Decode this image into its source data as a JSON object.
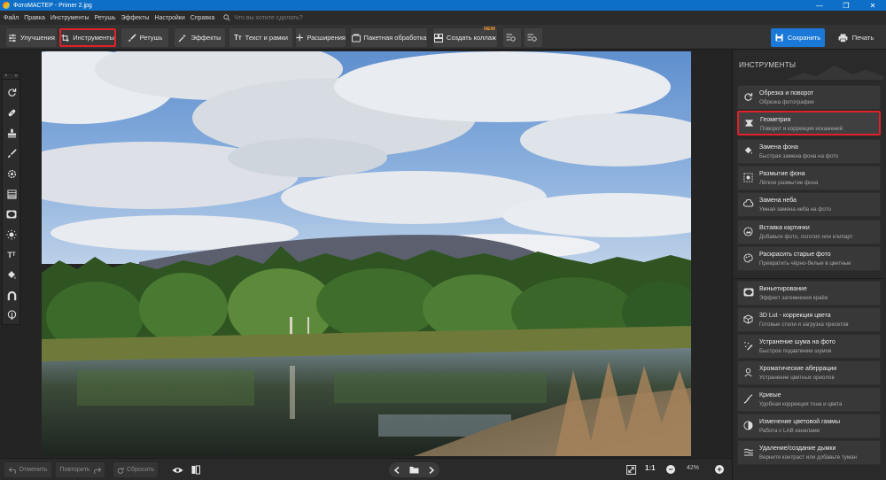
{
  "window": {
    "title": "ФотоМАСТЕР - Primer 2.jpg",
    "minimize": "—",
    "maximize": "❐",
    "close": "✕"
  },
  "menu": {
    "items": [
      "Файл",
      "Правка",
      "Инструменты",
      "Ретушь",
      "Эффекты",
      "Настройки",
      "Справка"
    ],
    "search_placeholder": "Что вы хотите сделать?"
  },
  "toolbar": {
    "improvements": "Улучшения",
    "tools": "Инструменты",
    "retouch": "Ретушь",
    "effects": "Эффекты",
    "text_frames": "Текст и рамки",
    "extensions": "Расширения",
    "batch": "Пакетная обработка",
    "collage": "Создать коллаж",
    "collage_badge": "NEW",
    "save": "Сохранить",
    "print": "Печать",
    "active_tab": "tools",
    "accent_color": "#1a78d8",
    "highlight_color": "#e0202a"
  },
  "left_tools": {
    "header_close": "×",
    "header_collapse": "«",
    "icons": [
      "rotate-icon",
      "patch-icon",
      "stamp-icon",
      "brush-icon",
      "gear-icon",
      "gradient-icon",
      "vignette-rect-icon",
      "sun-icon",
      "text-icon",
      "bucket-icon",
      "magnet-icon",
      "tree-icon"
    ]
  },
  "panel": {
    "title": "ИНСТРУМЕНТЫ",
    "items": [
      {
        "title": "Обрезка и поворот",
        "subtitle": "Обрезка фотографии",
        "icon": "crop-rotate-icon"
      },
      {
        "title": "Геометрия",
        "subtitle": "Поворот и коррекция искажений",
        "icon": "geometry-icon",
        "active": true
      },
      {
        "title": "Замена фона",
        "subtitle": "Быстрая замена фона на фото",
        "icon": "bucket-icon"
      },
      {
        "title": "Размытие фона",
        "subtitle": "Лёгкое размытие фона",
        "icon": "blur-icon"
      },
      {
        "title": "Замена неба",
        "subtitle": "Умная замена неба на фото",
        "icon": "cloud-icon"
      },
      {
        "title": "Вставка картинки",
        "subtitle": "Добавьте фото, логотип или клипарт",
        "icon": "image-insert-icon"
      },
      {
        "title": "Раскрасить старые фото",
        "subtitle": "Превратить чёрно-белые в цветные",
        "icon": "palette-icon"
      },
      {
        "title": "Виньетирование",
        "subtitle": "Эффект затемнения краёв",
        "icon": "vignette-icon"
      },
      {
        "title": "3D Lut - коррекция цвета",
        "subtitle": "Готовые стили и загрузка пресетов",
        "icon": "cube-icon"
      },
      {
        "title": "Устранение шума на фото",
        "subtitle": "Быстрое подавление шумов",
        "icon": "noise-icon"
      },
      {
        "title": "Хроматические аберрации",
        "subtitle": "Устранение цветных ореолов",
        "icon": "chromatic-icon"
      },
      {
        "title": "Кривые",
        "subtitle": "Удобная коррекция тона и цвета",
        "icon": "curves-icon"
      },
      {
        "title": "Изменение цветовой гаммы",
        "subtitle": "Работа с LAB каналами",
        "icon": "color-gamut-icon"
      },
      {
        "title": "Удаление/создание дымки",
        "subtitle": "Верните контраст или добавьте туман",
        "icon": "haze-icon"
      }
    ]
  },
  "bottom": {
    "undo": "Отменить",
    "redo": "Повторить",
    "reset": "Сбросить",
    "zoom_fit": "1:1",
    "zoom_value": "42%",
    "zoom_minus": "−",
    "zoom_plus": "+"
  }
}
